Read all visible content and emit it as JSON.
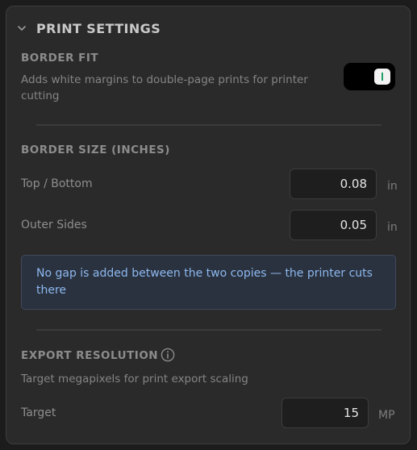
{
  "header": {
    "title": "PRINT SETTINGS",
    "icon": "chevron-down-icon"
  },
  "border_fit": {
    "title": "BORDER FIT",
    "description": "Adds white margins to double-page prints for printer cutting",
    "toggle_on": true
  },
  "border_size": {
    "title": "BORDER SIZE (INCHES)",
    "top_bottom": {
      "label": "Top / Bottom",
      "value": "0.08",
      "unit": "in"
    },
    "outer_sides": {
      "label": "Outer Sides",
      "value": "0.05",
      "unit": "in"
    },
    "info_text": "No gap is added between the two copies — the printer cuts there"
  },
  "export_resolution": {
    "title": "EXPORT RESOLUTION",
    "icon": "info-icon",
    "description": "Target megapixels for print export scaling",
    "target": {
      "label": "Target",
      "value": "15",
      "unit": "MP"
    }
  },
  "colors": {
    "panel": "#2a2a2a",
    "toggle_track": "#000000",
    "toggle_accent": "#1f9f63",
    "info_text": "#8cb8ef",
    "info_background": "#2b323f"
  }
}
